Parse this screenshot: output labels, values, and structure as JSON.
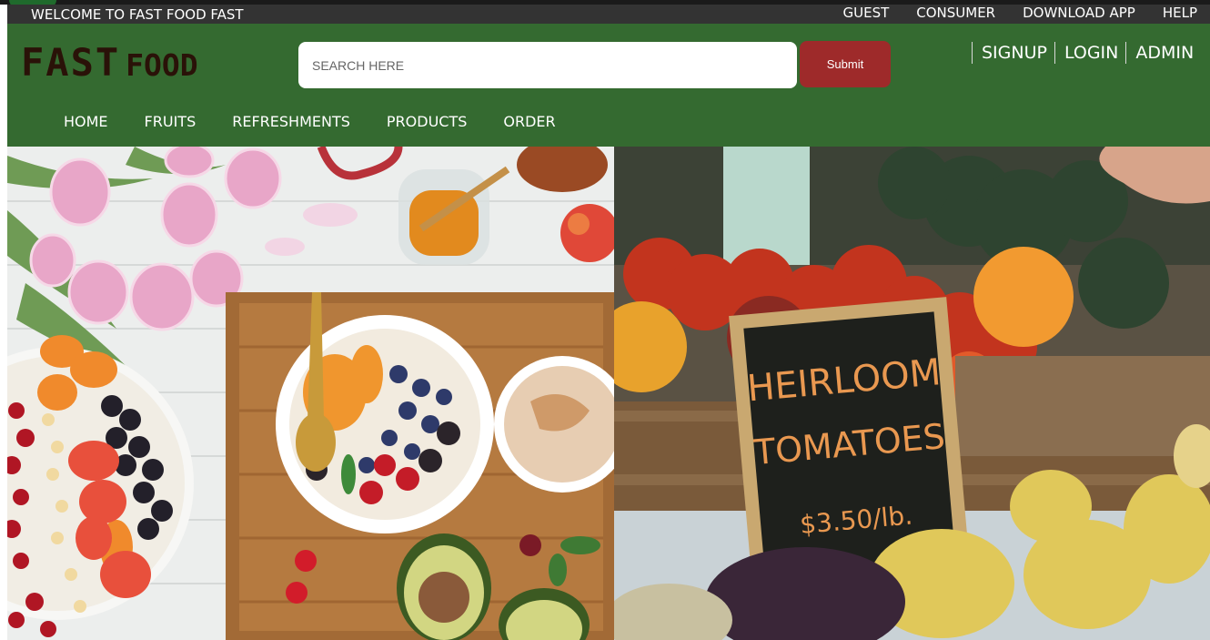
{
  "topbar": {
    "welcome": "WELCOME TO FAST FOOD FAST",
    "links": [
      "GUEST",
      "CONSUMER",
      "DOWNLOAD APP",
      "HELP"
    ]
  },
  "header": {
    "logo_word1": "FAST",
    "logo_word2": "FOOD",
    "search_placeholder": "SEARCH HERE",
    "submit_label": "Submit",
    "auth_links": [
      "SIGNUP",
      "LOGIN",
      "ADMIN"
    ]
  },
  "nav": {
    "items": [
      "HOME",
      "FRUITS",
      "REFRESHMENTS",
      "PRODUCTS",
      "ORDER"
    ]
  },
  "hero": {
    "left_image": "breakfast-flatlay",
    "right_image": "market-stall",
    "sign_line1": "HEIRLOOM",
    "sign_line2": "TOMATOES",
    "sign_price": "$3.50/lb."
  },
  "colors": {
    "topbar": "#333333",
    "header_green": "#346a30",
    "submit_red": "#9e2a2a",
    "logo_brown": "#2a1208"
  }
}
